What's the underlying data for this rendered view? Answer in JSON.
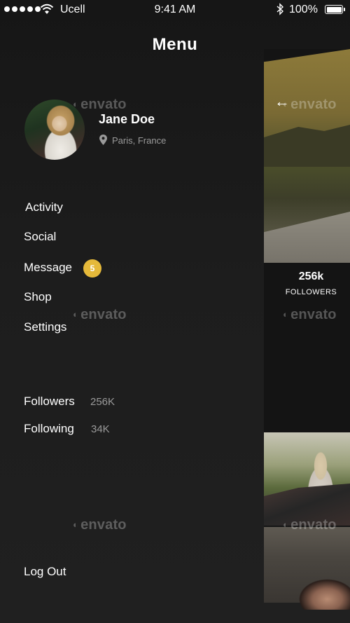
{
  "status_bar": {
    "carrier": "Ucell",
    "time": "9:41 AM",
    "battery": "100%"
  },
  "header": {
    "title": "Menu"
  },
  "profile": {
    "name": "Jane Doe",
    "location": "Paris, France"
  },
  "nav": {
    "items": [
      {
        "label": "Activity"
      },
      {
        "label": "Social"
      },
      {
        "label": "Message",
        "badge": "5"
      },
      {
        "label": "Shop"
      },
      {
        "label": "Settings"
      }
    ]
  },
  "stats": {
    "followers_label": "Followers",
    "followers_value": "256K",
    "following_label": "Following",
    "following_value": "34K"
  },
  "footer": {
    "logout_label": "Log Out"
  },
  "background_panel": {
    "back_icon": "arrow-left-icon",
    "followers_count": "256k",
    "followers_label": "FOLLOWERS"
  },
  "watermark": {
    "text": "envato"
  },
  "colors": {
    "background": "#1c1c1c",
    "badge": "#e5b93a",
    "secondary_text": "#9a9a9a"
  }
}
